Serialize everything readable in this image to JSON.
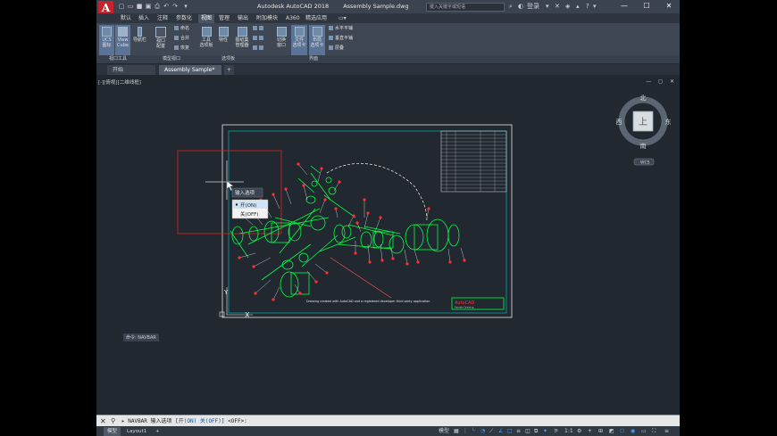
{
  "titlebar": {
    "logo": "A",
    "app_title": "Autodesk AutoCAD 2018",
    "file_title": "Assembly Sample.dwg",
    "search_placeholder": "键入关键字或短语",
    "user": "登录",
    "help": "?"
  },
  "ribbon_tabs": [
    "默认",
    "插入",
    "注释",
    "参数化",
    "视图",
    "管理",
    "输出",
    "附加模块",
    "A360",
    "精选应用"
  ],
  "active_ribbon_tab": "视图",
  "ribbon": {
    "ucs_icon_label": "UCS\n图标",
    "viewcube_label": "View\nCube",
    "navbar_label": "导航栏",
    "viewport_config_label": "视口\n配置",
    "named_label": "命名",
    "join_label": "合并",
    "restore_label": "恢复",
    "tool_palettes_label": "工具\n选项板",
    "properties_label": "特性",
    "sheetset_label": "图纸集\n管理器",
    "switch_window_label": "切换\n窗口",
    "file_tabs_label": "文件\n选项卡",
    "layout_tabs_label": "布局\n选项卡",
    "tile_h_label": "水平平铺",
    "tile_v_label": "垂直平铺",
    "cascade_label": "层叠",
    "panels": [
      "视口工具",
      "模型视口",
      "选项板",
      "界面"
    ]
  },
  "doc_tabs": [
    "开始",
    "Assembly Sample*"
  ],
  "viewport": {
    "control_label": "[-][俯视][二维线框]",
    "viewcube": {
      "north": "北",
      "south": "南",
      "east": "东",
      "west": "西",
      "face": "上",
      "wcs": "WCS"
    },
    "context_menu": {
      "header": "输入选项",
      "items": [
        "开(ON)",
        "关(OFF)"
      ]
    },
    "drawing_note": "Drawing created with AutoCAD and a registered developer third party application",
    "title_block": "AutoCAD",
    "title_block_sub": "Sample Drawing",
    "navbar_tip": "命令: NAVBAR"
  },
  "command_line": {
    "prompt_prefix": "NAVBAR 输入选项 [",
    "opt_on": "开(ON)",
    "opt_off": "关(OFF)",
    "prompt_suffix": "] <OFF>:"
  },
  "status_bar": {
    "tabs": [
      "模型",
      "Layout1"
    ],
    "model_label": "模型",
    "scale": "1:1"
  },
  "colors": {
    "drawing_green": "#00ff44",
    "frame_red": "#ff3a3a",
    "border_cyan": "#00c8c8",
    "accent_blue": "#47a3ff"
  }
}
